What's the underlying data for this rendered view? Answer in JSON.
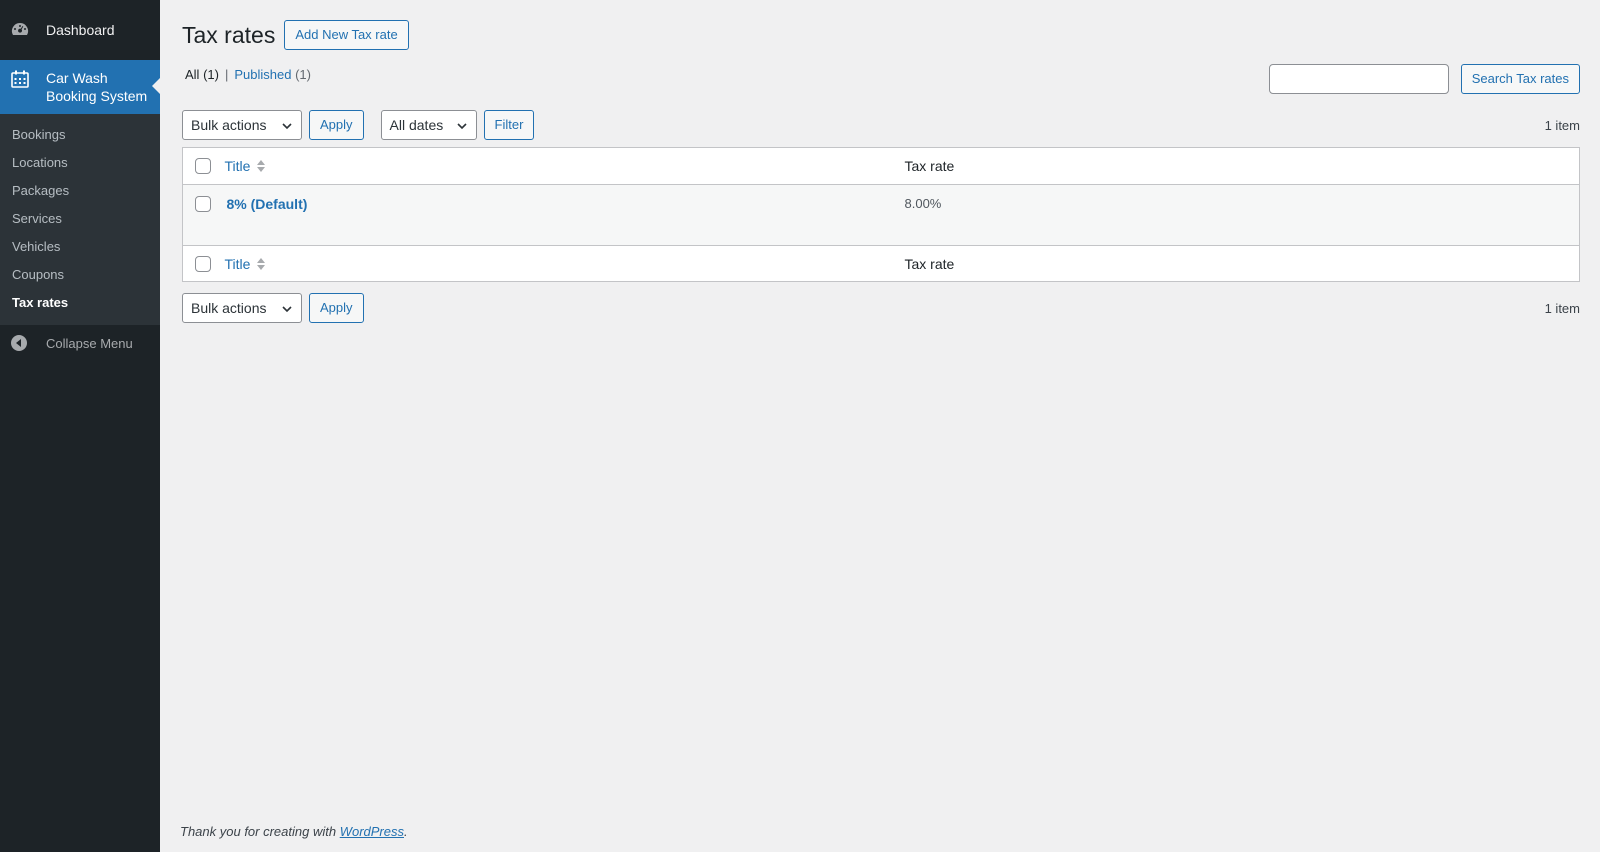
{
  "sidebar": {
    "dashboard_label": "Dashboard",
    "current_menu_label_line1": "Car Wash",
    "current_menu_label_line2": "Booking System",
    "submenu": [
      {
        "label": "Bookings"
      },
      {
        "label": "Locations"
      },
      {
        "label": "Packages"
      },
      {
        "label": "Services"
      },
      {
        "label": "Vehicles"
      },
      {
        "label": "Coupons"
      },
      {
        "label": "Tax rates"
      }
    ],
    "collapse_label": "Collapse Menu"
  },
  "page": {
    "title": "Tax rates",
    "add_new_label": "Add New Tax rate",
    "views": {
      "all_label": "All",
      "all_count": "(1)",
      "separator": "|",
      "published_label": "Published",
      "published_count": "(1)"
    },
    "search_button_label": "Search Tax rates",
    "search_value": ""
  },
  "tablenav_top": {
    "bulk_actions": "Bulk actions",
    "apply_label": "Apply",
    "dates_filter": "All dates",
    "filter_label": "Filter",
    "num_items": "1 item"
  },
  "table": {
    "columns": {
      "title": "Title",
      "tax_rate": "Tax rate"
    },
    "rows": [
      {
        "title": "8% (Default)",
        "tax_rate": "8.00%"
      }
    ]
  },
  "tablenav_bottom": {
    "bulk_actions": "Bulk actions",
    "apply_label": "Apply",
    "num_items": "1 item"
  },
  "footer": {
    "text_before": "Thank you for creating with ",
    "link_label": "WordPress",
    "text_after": "."
  },
  "colors": {
    "sidebar_bg": "#1d2327",
    "accent": "#2271b1",
    "page_bg": "#f0f0f1"
  }
}
